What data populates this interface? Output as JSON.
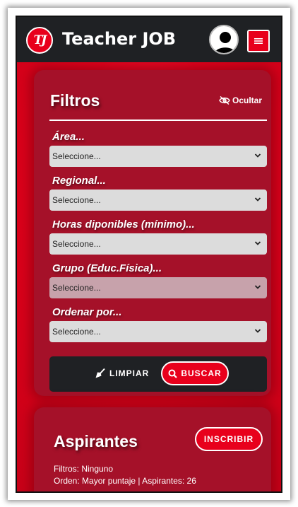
{
  "header": {
    "logo_text": "TJ",
    "brand": "Teacher JOB",
    "avatar_icon": "user-icon",
    "menu_icon": "hamburger-icon"
  },
  "filters": {
    "title": "Filtros",
    "toggle_label": "Ocultar",
    "toggle_icon": "eye-slash-icon",
    "fields": [
      {
        "label": "Área...",
        "value": "Seleccione..."
      },
      {
        "label": "Regional...",
        "value": "Seleccione..."
      },
      {
        "label": "Horas diponibles (mínimo)...",
        "value": "Seleccione..."
      },
      {
        "label": "Grupo (Educ.Física)...",
        "value": "Seleccione..."
      },
      {
        "label": "Ordenar por...",
        "value": "Seleccione..."
      }
    ],
    "clear_label": "LIMPIAR",
    "clear_icon": "broom-icon",
    "search_label": "BUSCAR",
    "search_icon": "search-icon"
  },
  "applicants": {
    "title": "Aspirantes",
    "enroll_label": "INSCRIBIR",
    "filters_line": "Filtros: Ninguno",
    "order_line": "Orden: Mayor puntaje | Aspirantes: 26"
  },
  "colors": {
    "brand_red": "#e8001c",
    "card": "#a51129",
    "navbar": "#1f2124"
  }
}
